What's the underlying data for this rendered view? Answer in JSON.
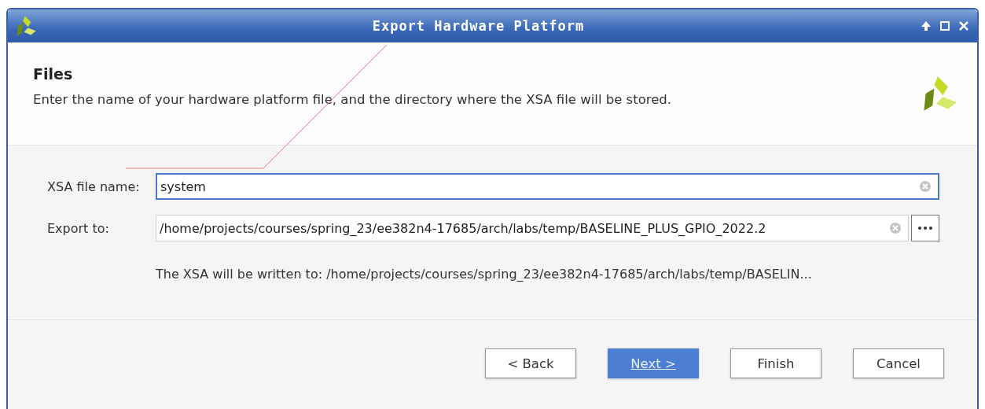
{
  "window": {
    "title": "Export Hardware Platform"
  },
  "header": {
    "title": "Files",
    "description": "Enter the name of your hardware platform file, and the directory where the XSA file will be stored."
  },
  "fields": [
    {
      "label": "XSA file name:",
      "value": "system",
      "focused": true,
      "browse": false
    },
    {
      "label": "Export to:",
      "value": "/home/projects/courses/spring_23/ee382n4-17685/arch/labs/temp/BASELINE_PLUS_GPIO_2022.2",
      "focused": false,
      "browse": true
    }
  ],
  "note": "The XSA will be written to: /home/projects/courses/spring_23/ee382n4-17685/arch/labs/temp/BASELIN...",
  "buttons": [
    {
      "label": "< Back",
      "default": false
    },
    {
      "label": "Next >",
      "default": true
    },
    {
      "label": "Finish",
      "default": false
    },
    {
      "label": "Cancel",
      "default": false
    }
  ]
}
